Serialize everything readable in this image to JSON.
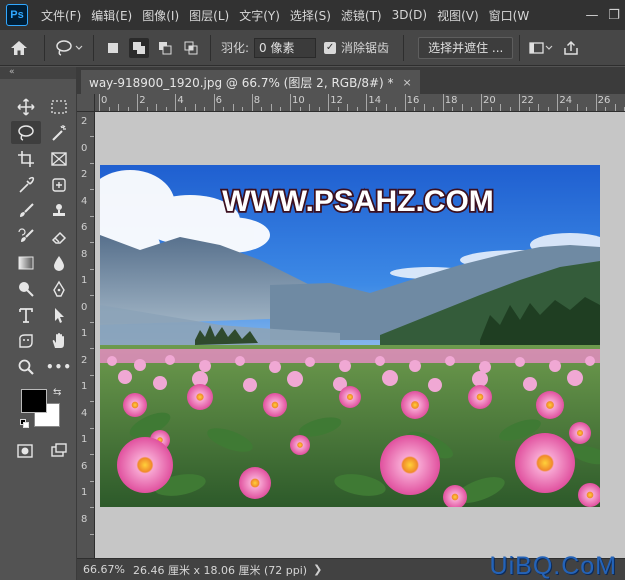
{
  "app": {
    "logo": "Ps"
  },
  "menu": [
    "文件(F)",
    "编辑(E)",
    "图像(I)",
    "图层(L)",
    "文字(Y)",
    "选择(S)",
    "滤镜(T)",
    "3D(D)",
    "视图(V)",
    "窗口(W"
  ],
  "window_controls": {
    "minimize": "—",
    "restore": "❐"
  },
  "options": {
    "feather_label": "羽化:",
    "feather_value": "0 像素",
    "anti_alias_label": "消除锯齿",
    "anti_alias_checked": true,
    "select_mask_label": "选择并遮住 ..."
  },
  "toolbar": {
    "collapse": "«"
  },
  "document": {
    "tab_title": "way-918900_1920.jpg @ 66.7% (图层 2, RGB/8#) *",
    "close": "×",
    "image_text": "WWW.PSAHZ.COM"
  },
  "rulers": {
    "h_labels": [
      "0",
      "2",
      "4",
      "6",
      "8",
      "10",
      "12",
      "14",
      "16",
      "18",
      "20",
      "22",
      "24",
      "26"
    ],
    "v_labels": [
      "2",
      "0",
      "2",
      "4",
      "6",
      "8",
      "1",
      "0",
      "1",
      "2",
      "1",
      "4",
      "1",
      "6",
      "1",
      "8"
    ]
  },
  "status": {
    "zoom": "66.67%",
    "doc_info": "26.46 厘米 x 18.06 厘米 (72 ppi)",
    "arrow": "❯"
  },
  "watermark": "UiBQ.CoM",
  "colors": {
    "foreground": "#000000",
    "background": "#ffffff",
    "accent": "#31a8ff"
  }
}
